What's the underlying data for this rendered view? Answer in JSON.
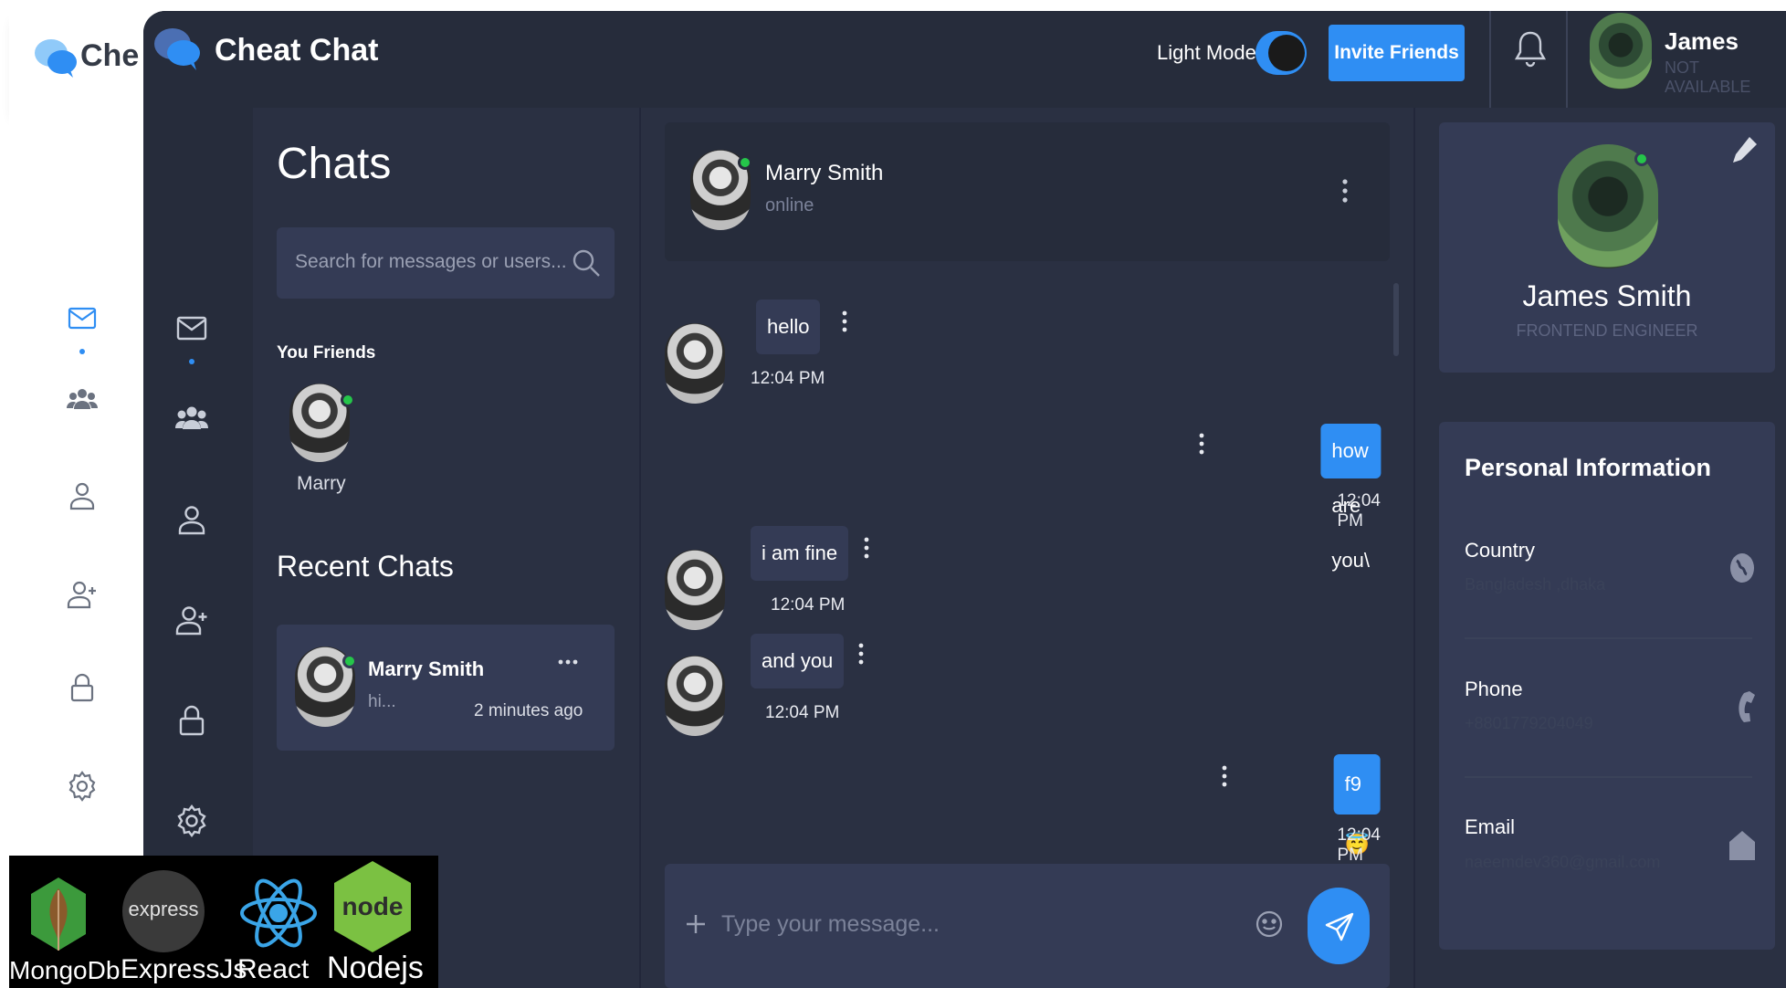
{
  "app": {
    "brand": "Cheat Chat",
    "bg_brand_fragment": "Che",
    "light_mode_label": "Light Mode",
    "invite_button": "Invite Friends",
    "user_name": "James",
    "user_status": "NOT AVAILABLE"
  },
  "chats": {
    "title": "Chats",
    "search_placeholder": "Search for messages or users...",
    "friends_title": "You Friends",
    "friends": [
      {
        "name": "Marry"
      }
    ],
    "recent_title": "Recent Chats",
    "recent": [
      {
        "name": "Marry Smith",
        "preview": "hi...",
        "time": "2 minutes ago"
      }
    ]
  },
  "conversation": {
    "contact_name": "Marry Smith",
    "contact_status": "online",
    "messages": [
      {
        "dir": "in",
        "text": "hello",
        "time": "12:04 PM"
      },
      {
        "dir": "out",
        "text": "how are you\\",
        "time": "12:04 PM"
      },
      {
        "dir": "in",
        "text": "i am fine",
        "time": "12:04 PM"
      },
      {
        "dir": "in",
        "text": "and you",
        "time": "12:04 PM"
      },
      {
        "dir": "out",
        "text": "f9 😇 😇",
        "time": "12:04 PM"
      }
    ],
    "input_placeholder": "Type your message..."
  },
  "profile": {
    "name": "James Smith",
    "role": "FRONTEND ENGINEER",
    "section_title": "Personal Information",
    "fields": [
      {
        "label": "Country",
        "value": "Bangladesh ,dhaka"
      },
      {
        "label": "Phone",
        "value": "+8801779204049"
      },
      {
        "label": "Email",
        "value": "naeemdev360@gmail.com"
      }
    ]
  },
  "tech_stack": [
    {
      "name": "MongoDb",
      "badge": ""
    },
    {
      "name": "ExpressJs",
      "badge": "express"
    },
    {
      "name": "React",
      "badge": ""
    },
    {
      "name": "Nodejs",
      "badge": "node"
    }
  ],
  "colors": {
    "accent": "#2f8ef3",
    "online": "#25c54a",
    "panel": "#2a3042",
    "card": "#343b55"
  }
}
